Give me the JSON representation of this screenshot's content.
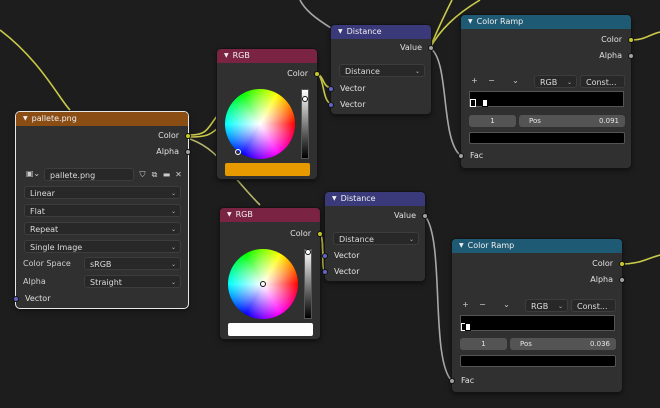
{
  "image_node": {
    "title": "pallete.png",
    "outputs": [
      "Color",
      "Alpha"
    ],
    "image_name": "pallete.png",
    "interpolation": "Linear",
    "projection": "Flat",
    "extension": "Repeat",
    "source": "Single Image",
    "color_space_label": "Color Space",
    "color_space": "sRGB",
    "alpha_label": "Alpha",
    "alpha_mode": "Straight",
    "input_vector": "Vector"
  },
  "rgb_top": {
    "title": "RGB",
    "output": "Color",
    "swatch_color": "#e69a00"
  },
  "rgb_bottom": {
    "title": "RGB",
    "output": "Color",
    "swatch_color": "#ffffff"
  },
  "distance_top": {
    "title": "Distance",
    "output": "Value",
    "mode": "Distance",
    "inputs": [
      "Vector",
      "Vector"
    ]
  },
  "distance_bottom": {
    "title": "Distance",
    "output": "Value",
    "mode": "Distance",
    "inputs": [
      "Vector",
      "Vector"
    ]
  },
  "ramp_top": {
    "title": "Color Ramp",
    "outputs": [
      "Color",
      "Alpha"
    ],
    "mode": "RGB",
    "interp": "Const...",
    "stop_index": "1",
    "pos_label": "Pos",
    "pos_value": "0.091",
    "input_fac": "Fac"
  },
  "ramp_bottom": {
    "title": "Color Ramp",
    "outputs": [
      "Color",
      "Alpha"
    ],
    "mode": "RGB",
    "interp": "Const...",
    "stop_index": "1",
    "pos_label": "Pos",
    "pos_value": "0.036",
    "input_fac": "Fac"
  },
  "colors": {
    "background": "#1d1d1d",
    "node_body": "#303030",
    "texture_header": "#8a4d14",
    "color_header": "#7a2342",
    "vector_header": "#3a3a7a",
    "converter_header": "#1f5a75",
    "socket_color": "#c7c729",
    "socket_gray": "#a1a1a1",
    "socket_vector": "#6363c7"
  }
}
